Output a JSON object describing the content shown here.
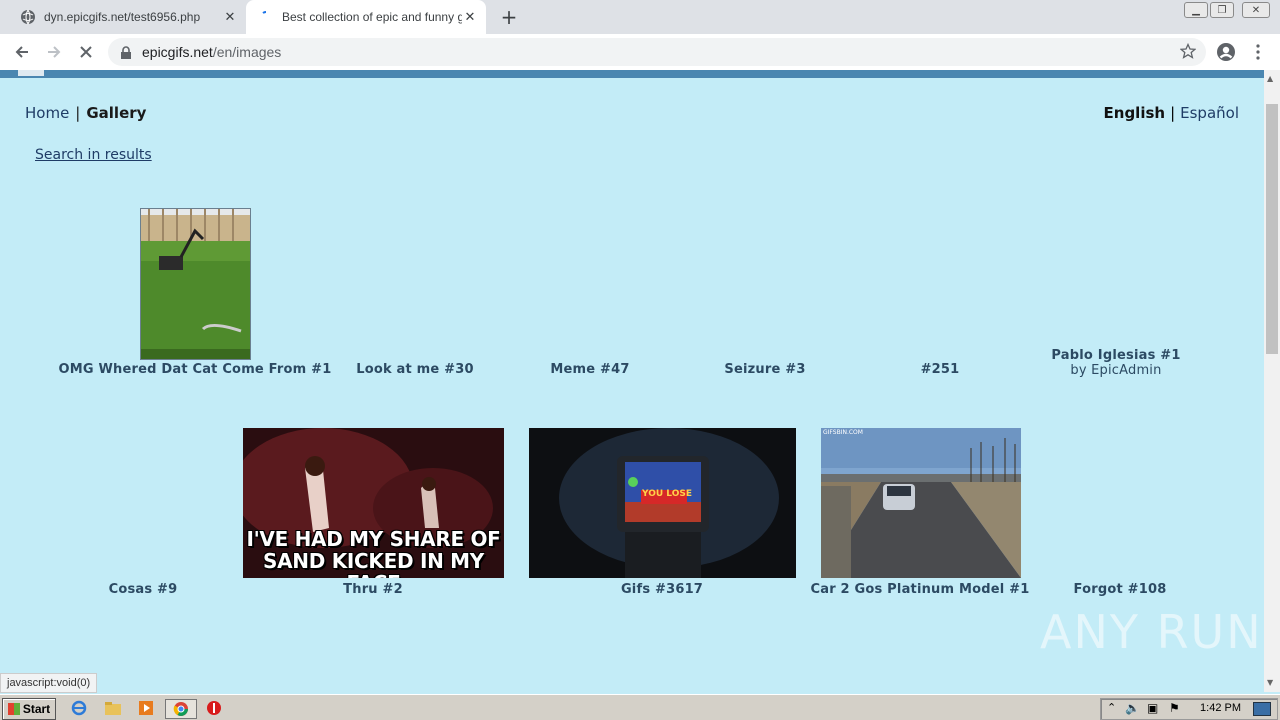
{
  "browser": {
    "tabs": [
      {
        "title": "dyn.epicgifs.net/test6956.php",
        "favicon": "globe-icon"
      },
      {
        "title": "Best collection of epic and funny gifs",
        "favicon": "loading-icon"
      }
    ],
    "url_host": "epicgifs.net",
    "url_path": "/en/images"
  },
  "nav": {
    "home": "Home",
    "gallery": "Gallery",
    "lang_current": "English",
    "lang_other": "Español",
    "search_link": "Search in results"
  },
  "gallery": {
    "row1": [
      {
        "caption": "OMG Whered Dat Cat Come From #1"
      },
      {
        "caption": "Look at me #30"
      },
      {
        "caption": "Meme #47"
      },
      {
        "caption": "Seizure #3"
      },
      {
        "caption": "#251"
      },
      {
        "caption": "Pablo Iglesias #1",
        "byline": "by EpicAdmin"
      }
    ],
    "row2": [
      {
        "caption": "Cosas #9"
      },
      {
        "caption": "Thru #2",
        "overlay_line1": "I'VE HAD MY SHARE OF",
        "overlay_line2": "SAND KICKED IN MY FACE"
      },
      {
        "caption": "Gifs #3617",
        "screen_text": "YOU LOSE"
      },
      {
        "caption": "Car 2 Gos Platinum Model #1",
        "corner_text": "GIFSBIN.COM"
      },
      {
        "caption": "Forgot #108"
      }
    ]
  },
  "status_text": "javascript:void(0)",
  "watermark": "ANY RUN",
  "taskbar": {
    "start_label": "Start",
    "clock": "1:42 PM"
  }
}
